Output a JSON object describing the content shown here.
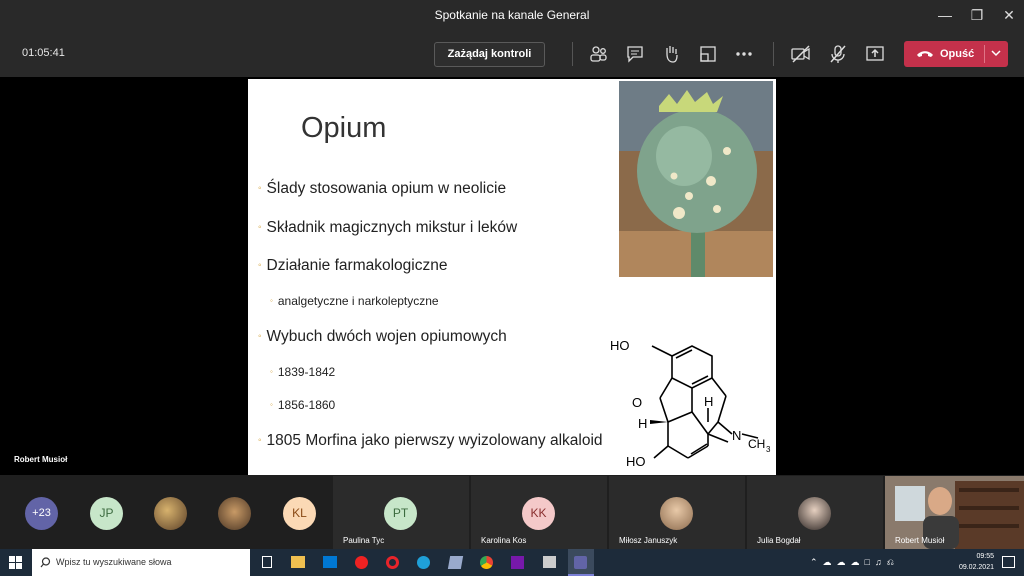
{
  "window": {
    "title": "Spotkanie na kanale General"
  },
  "toolbar": {
    "timer": "01:05:41",
    "request_control": "Zażądaj kontroli",
    "leave": "Opuść"
  },
  "presenter": {
    "name": "Robert Musioł"
  },
  "slide": {
    "title": "Opium",
    "bullets": [
      "Ślady stosowania opium w neolicie",
      "Składnik magicznych mikstur i leków",
      "Działanie farmakologiczne",
      "analgetyczne i narkoleptyczne",
      "Wybuch dwóch wojen opiumowych",
      "1839-1842",
      "1856-1860",
      "1805 Morfina jako pierwszy wyizolowany alkaloid"
    ],
    "molecule": {
      "ho_top": "HO",
      "o": "O",
      "h1": "H",
      "h2": "H",
      "n": "N",
      "ch3": "CH",
      "sub3": "3",
      "ho_bottom": "HO"
    }
  },
  "participants": {
    "more": "+23",
    "avatars": [
      {
        "initials": "JP",
        "color": "#c7e6c9"
      },
      {
        "initials": "KL",
        "color": "#fbd9b5"
      }
    ],
    "tiles": [
      {
        "initials": "PT",
        "name": "Paulina Tyc",
        "color": "#c7e6c9"
      },
      {
        "initials": "KK",
        "name": "Karolina Kos",
        "color": "#f4c9c9"
      },
      {
        "initials": "",
        "name": "Miłosz Januszyk"
      },
      {
        "initials": "",
        "name": "Julia Bogdał"
      },
      {
        "initials": "",
        "name": "Robert Musioł"
      }
    ]
  },
  "taskbar": {
    "search_placeholder": "Wpisz tu wyszukiwane słowa",
    "time": "09:55",
    "date": "09.02.2021"
  },
  "colors": {
    "leave": "#c4314b",
    "bullet": "#d4a23a",
    "toolbar": "#292929"
  }
}
